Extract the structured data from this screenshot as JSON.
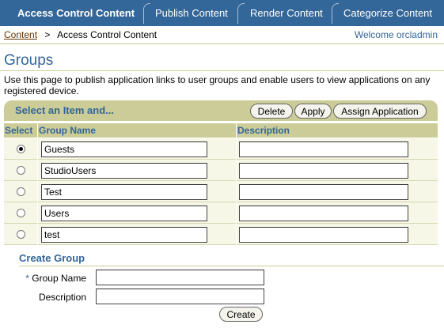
{
  "tabs": [
    {
      "label": "Access Control Content",
      "active": true
    },
    {
      "label": "Publish Content",
      "active": false
    },
    {
      "label": "Render Content",
      "active": false
    },
    {
      "label": "Categorize Content",
      "active": false
    }
  ],
  "breadcrumb": {
    "link": "Content",
    "separator": ">",
    "current": "Access Control Content"
  },
  "welcome": "Welcome orcladmin",
  "page": {
    "title": "Groups",
    "description": "Use this page to publish application links to user groups and enable users to view applications on any registered device."
  },
  "control_bar": {
    "title": "Select an Item and...",
    "buttons": {
      "delete": "Delete",
      "apply": "Apply",
      "assign": "Assign Application"
    }
  },
  "table": {
    "headers": {
      "select": "Select",
      "group_name": "Group Name",
      "description": "Description"
    },
    "rows": [
      {
        "group_name": "Guests",
        "description": "",
        "selected": true
      },
      {
        "group_name": "StudioUsers",
        "description": "",
        "selected": false
      },
      {
        "group_name": "Test",
        "description": "",
        "selected": false
      },
      {
        "group_name": "Users",
        "description": "",
        "selected": false
      },
      {
        "group_name": "test",
        "description": "",
        "selected": false
      }
    ]
  },
  "create_group": {
    "title": "Create Group",
    "required_marker": "*",
    "group_name_label": "Group Name",
    "group_name_value": "",
    "description_label": "Description",
    "description_value": "",
    "create_button": "Create"
  },
  "colors": {
    "brand": "#336699",
    "bar": "#cccc99",
    "row": "#f7f7e7",
    "link": "#663300"
  }
}
